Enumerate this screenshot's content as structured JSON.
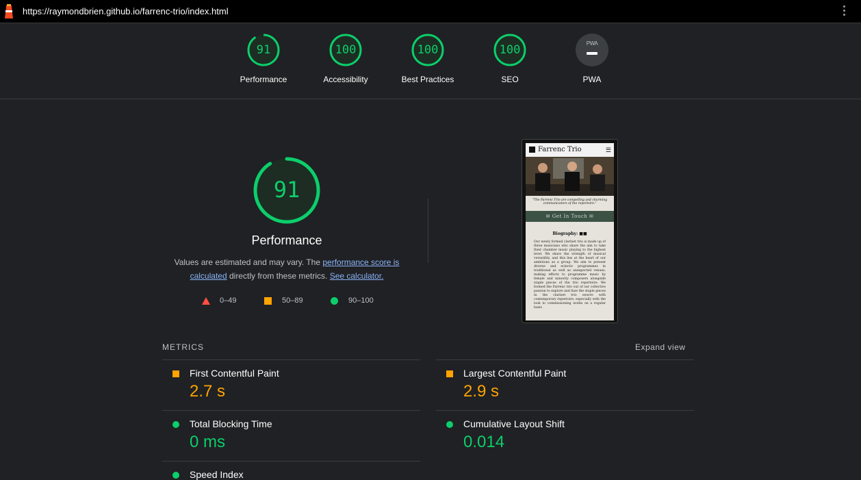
{
  "browser": {
    "url": "https://raymondbrien.github.io/farrenc-trio/index.html"
  },
  "scores": [
    {
      "label": "Performance",
      "value": "91",
      "score": 91
    },
    {
      "label": "Accessibility",
      "value": "100",
      "score": 100
    },
    {
      "label": "Best Practices",
      "value": "100",
      "score": 100
    },
    {
      "label": "SEO",
      "value": "100",
      "score": 100
    },
    {
      "label": "PWA",
      "badge": "PWA"
    }
  ],
  "performance": {
    "score": "91",
    "score_value": 91,
    "title": "Performance",
    "desc_pre": "Values are estimated and may vary. The ",
    "desc_link1": "performance score is calculated",
    "desc_mid": " directly from these metrics. ",
    "desc_link2": "See calculator.",
    "legend": [
      {
        "range": "0–49",
        "shape": "triangle",
        "color": "#ff4e42"
      },
      {
        "range": "50–89",
        "shape": "square",
        "color": "#ffa400"
      },
      {
        "range": "90–100",
        "shape": "circle",
        "color": "#0cce6b"
      }
    ]
  },
  "preview": {
    "brand": "Farrenc Trio",
    "quote": "\"The Farrenc Trio are compelling and charming communicators of the repertoire.\"",
    "button": "Get In Touch",
    "bio_title": "Biography:",
    "bio_text": "Our newly formed clarinet trio is made up of three musicians who share the aim to take their chamber music playing to the highest level. We share the strength of musical versatility, and this lies at the heart of our ambitions as a group. We aim to present diverse and eclectic programmes in traditional as well as unexpected venues, making efforts to programme music by female and minority composers alongside staple pieces of the trio repertoire. We formed the Farrenc trio out of our collective passion to explore and fuse the staple pieces in the clarinet trio oeuvre with contemporary repertoire, especially with the look to commissioning works on a regular basis"
  },
  "metrics": {
    "heading": "METRICS",
    "expand": "Expand view",
    "items": [
      {
        "title": "First Contentful Paint",
        "value": "2.7 s",
        "rating": "average"
      },
      {
        "title": "Largest Contentful Paint",
        "value": "2.9 s",
        "rating": "average"
      },
      {
        "title": "Total Blocking Time",
        "value": "0 ms",
        "rating": "pass"
      },
      {
        "title": "Cumulative Layout Shift",
        "value": "0.014",
        "rating": "pass"
      },
      {
        "title": "Speed Index",
        "value": "",
        "rating": "pass"
      }
    ]
  },
  "colors": {
    "pass": "#0cce6b",
    "average": "#ffa400",
    "fail": "#ff4e42",
    "link": "#8ab4f8"
  }
}
